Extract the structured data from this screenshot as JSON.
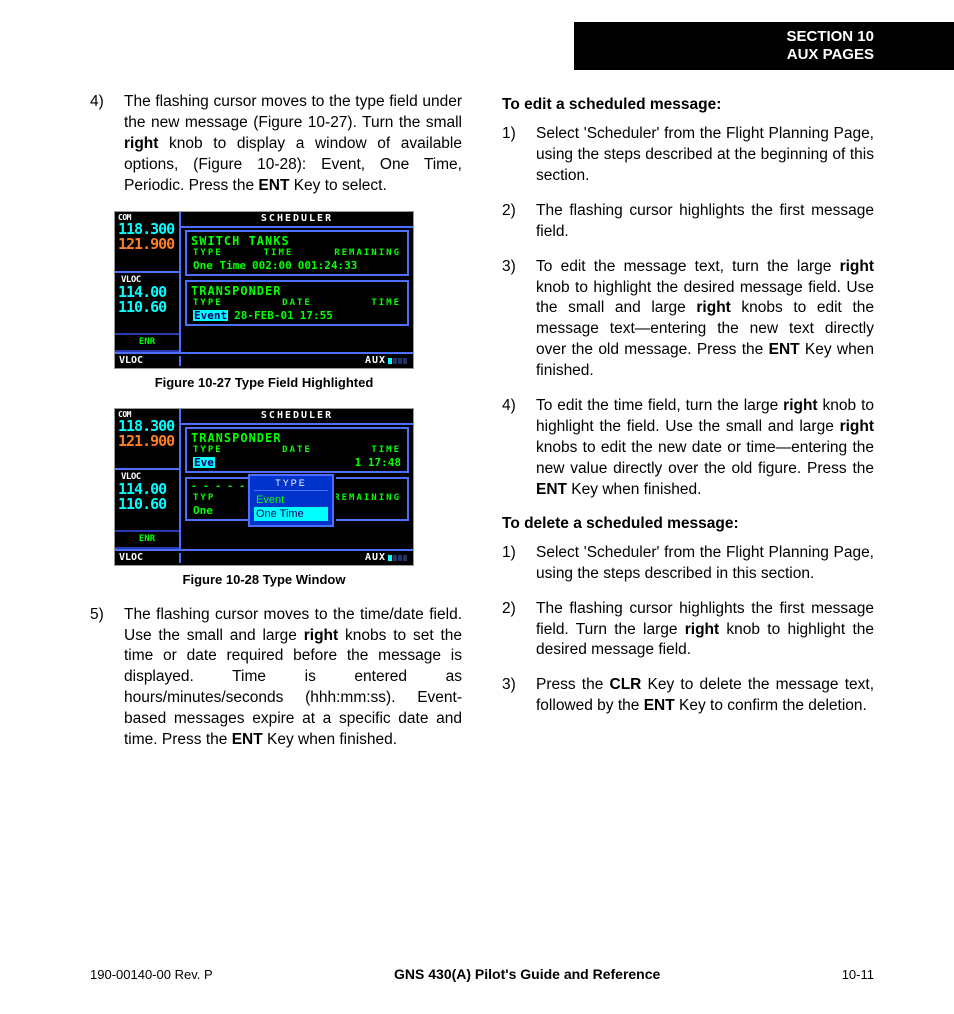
{
  "header": {
    "line1": "SECTION 10",
    "line2": "AUX PAGES"
  },
  "left": {
    "step4": {
      "num": "4)",
      "text_pre": "The flashing cursor moves to the type field under the new message (Figure 10-27).  Turn the small ",
      "bold1": "right",
      "text_mid": " knob to display a window of available options, (Figure 10-28): Event, One Time, Periodic.  Press the ",
      "bold2": "ENT",
      "text_post": " Key to select."
    },
    "fig27_caption": "Figure 10-27  Type Field Highlighted",
    "fig28_caption": "Figure 10-28  Type Window",
    "step5": {
      "num": "5)",
      "text_pre": "The flashing cursor moves to the time/date field.  Use the small and large ",
      "bold1": "right",
      "text_mid": " knobs to set the time or date required before the message is displayed.  Time is entered as hours/minutes/seconds (hhh:mm:ss).  Event-based messages expire at a specific date and time.  Press the ",
      "bold2": "ENT",
      "text_post": " Key when finished."
    },
    "device27": {
      "scheduler": "SCHEDULER",
      "com_lbl": "COM",
      "com_active": "118.300",
      "com_standby": "121.900",
      "vloc_lbl": "VLOC",
      "vloc_active": "114.00",
      "vloc_standby": "110.60",
      "enr": "ENR",
      "vloc_btm": "VLOC",
      "aux": "AUX",
      "box1_title": "SWITCH TANKS",
      "box1_hdr": [
        "TYPE",
        "TIME",
        "REMAINING"
      ],
      "box1_type": "One Time",
      "box1_time": "002:00",
      "box1_remaining": "001:24:33",
      "box2_title": "TRANSPONDER",
      "box2_hdr": [
        "TYPE",
        "DATE",
        "TIME"
      ],
      "box2_type": "Event",
      "box2_date": "28-FEB-01",
      "box2_time": "17:55"
    },
    "device28": {
      "scheduler": "SCHEDULER",
      "com_lbl": "COM",
      "com_active": "118.300",
      "com_standby": "121.900",
      "vloc_lbl": "VLOC",
      "vloc_active": "114.00",
      "vloc_standby": "110.60",
      "enr": "ENR",
      "vloc_btm": "VLOC",
      "aux": "AUX",
      "box1_title": "TRANSPONDER",
      "box1_hdr": [
        "TYPE",
        "DATE",
        "TIME"
      ],
      "box1_row_prefix": "Eve",
      "box1_row_time": "1 17:48",
      "box2_typ": "TYP",
      "box2_one": "One",
      "box2_remaining": "REMAINING",
      "popup_title": "TYPE",
      "popup_items": [
        "Event",
        "One Time"
      ]
    }
  },
  "right": {
    "edit_title": "To edit a scheduled message:",
    "e1": {
      "num": "1)",
      "text": "Select 'Scheduler' from the Flight Planning Page, using the steps described at the beginning of this section."
    },
    "e2": {
      "num": "2)",
      "text": "The flashing cursor highlights the first message field."
    },
    "e3": {
      "num": "3)",
      "pre": "To edit the message text, turn the large ",
      "b1": "right",
      "mid1": " knob to highlight the desired message field.  Use the small and large ",
      "b2": "right",
      "mid2": " knobs to edit the message text—entering the new text directly over the old message.  Press the ",
      "b3": "ENT",
      "post": " Key when finished."
    },
    "e4": {
      "num": "4)",
      "pre": "To edit the time field, turn the large ",
      "b1": "right",
      "mid1": " knob to highlight the field.  Use the small and large ",
      "b2": "right",
      "mid2": " knobs to edit the new date or time—entering the new value directly over the old figure.  Press the ",
      "b3": "ENT",
      "post": " Key when finished."
    },
    "delete_title": "To delete a scheduled message:",
    "d1": {
      "num": "1)",
      "text": "Select 'Scheduler' from the Flight Planning Page, using the steps described in this section."
    },
    "d2": {
      "num": "2)",
      "pre": "The flashing cursor highlights the first message field.  Turn the large ",
      "b1": "right",
      "post": " knob to highlight the desired message field."
    },
    "d3": {
      "num": "3)",
      "pre": "Press the ",
      "b1": "CLR",
      "mid": " Key to delete the message text, followed by the ",
      "b2": "ENT",
      "post": " Key to confirm the deletion."
    }
  },
  "footer": {
    "left": "190-00140-00  Rev. P",
    "center": "GNS 430(A) Pilot's Guide and Reference",
    "right": "10-11"
  }
}
